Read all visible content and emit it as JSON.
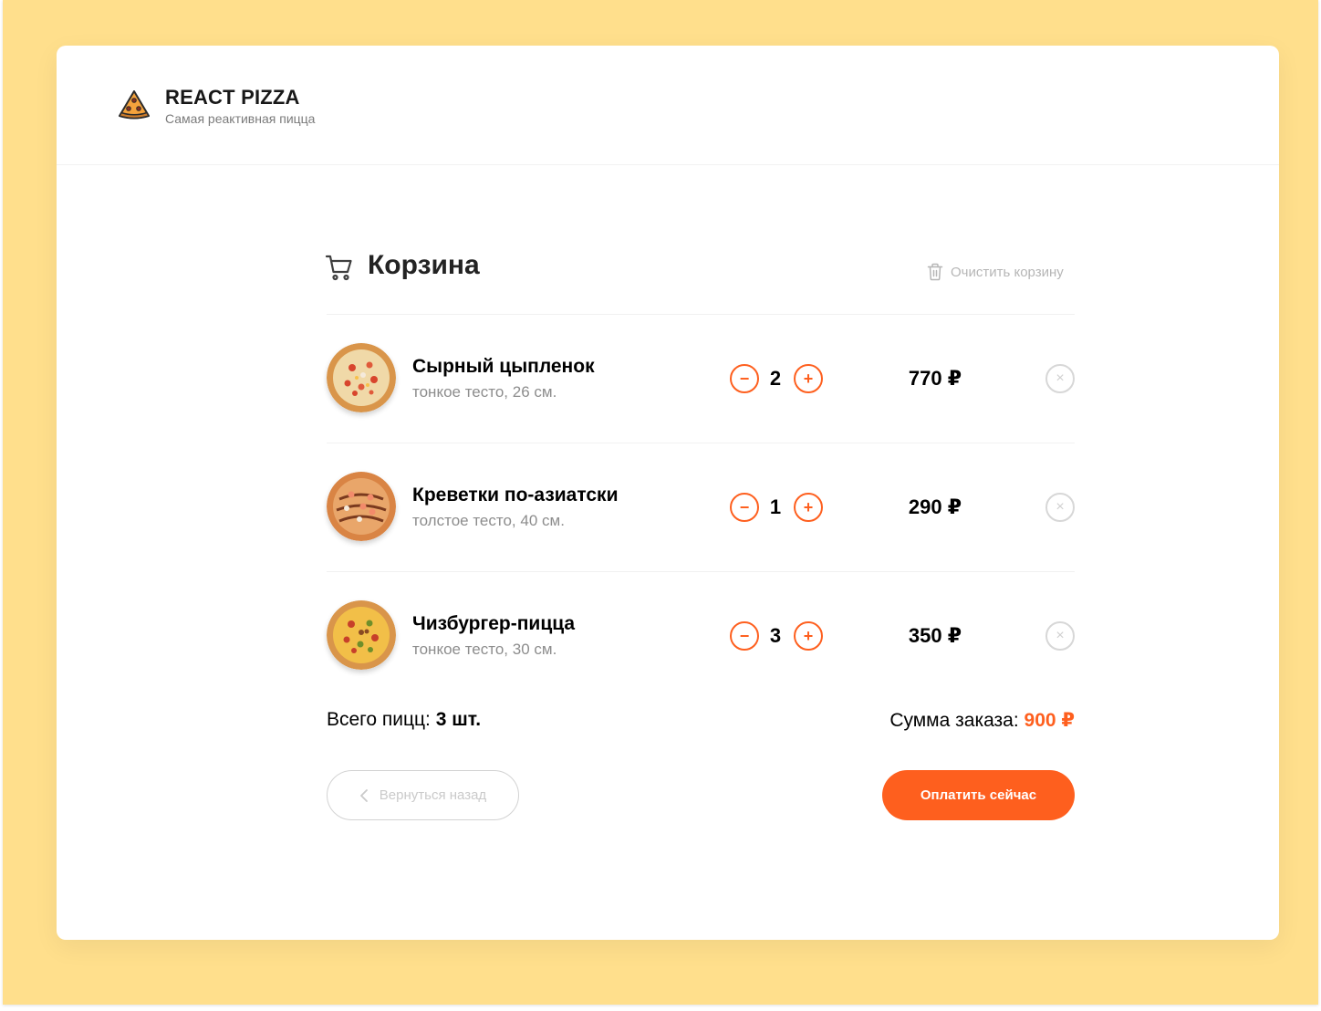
{
  "header": {
    "brand_title": "REACT PIZZA",
    "brand_subtitle": "Самая реактивная пицца",
    "logo_icon": "pizza-slice-icon"
  },
  "cart": {
    "title": "Корзина",
    "title_icon": "cart-icon",
    "clear_label": "Очистить корзину",
    "clear_icon": "trash-icon",
    "items": [
      {
        "name": "Сырный цыпленок",
        "desc": "тонкое тесто, 26 см.",
        "qty": "2",
        "price": "770 ₽"
      },
      {
        "name": "Креветки по-азиатски",
        "desc": "толстое тесто, 40 см.",
        "qty": "1",
        "price": "290 ₽"
      },
      {
        "name": "Чизбургер-пицца",
        "desc": "тонкое тесто, 30 см.",
        "qty": "3",
        "price": "350 ₽"
      }
    ],
    "qty_minus_label": "−",
    "qty_plus_label": "+",
    "remove_label": "×",
    "total_count_label": "Всего пицц: ",
    "total_count_value": "3 шт.",
    "total_sum_label": "Сумма заказа: ",
    "total_sum_value": "900 ₽",
    "back_label": "Вернуться назад",
    "pay_label": "Оплатить сейчас"
  },
  "colors": {
    "background": "#ffdf8c",
    "accent": "#fe5f1e",
    "muted": "#b6b6b6"
  }
}
